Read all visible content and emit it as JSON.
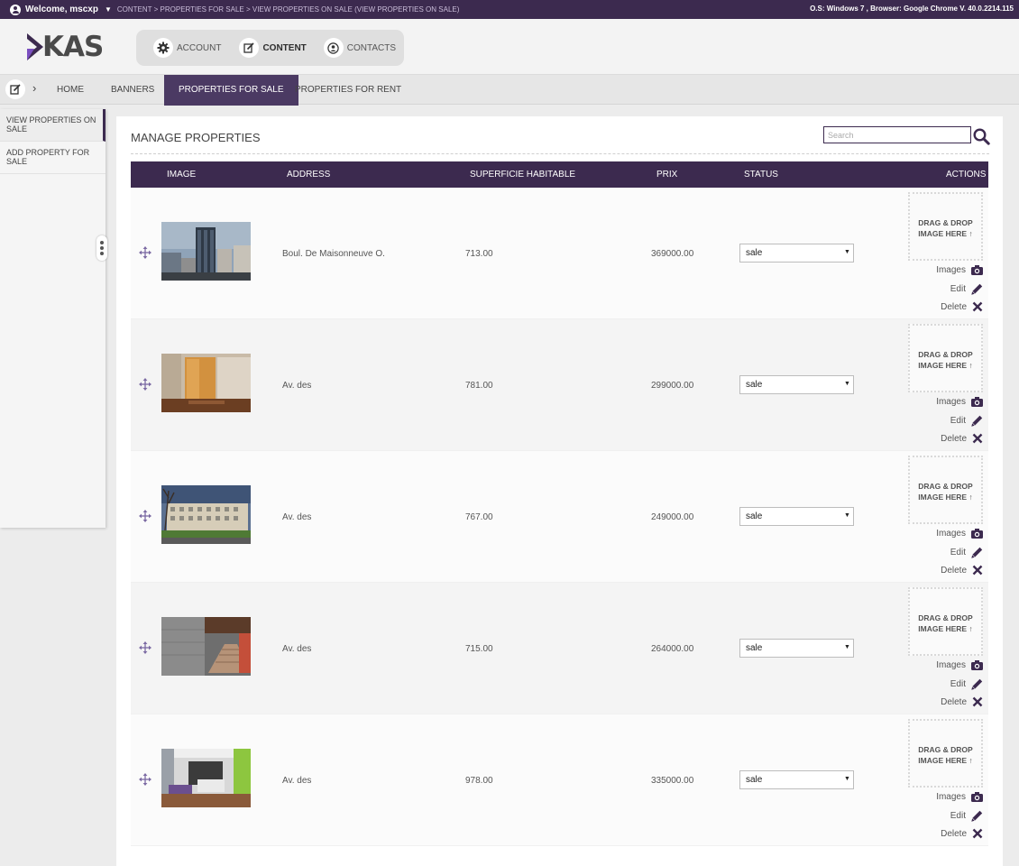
{
  "topbar": {
    "welcome": "Welcome, mscxp",
    "breadcrumb": "CONTENT > PROPERTIES FOR SALE > VIEW PROPERTIES ON SALE (VIEW PROPERTIES ON SALE)",
    "sysinfo": "O.S: Windows 7 , Browser: Google Chrome V. 40.0.2214.115"
  },
  "logo": {
    "text": "KAS"
  },
  "mainnav": {
    "account": "ACCOUNT",
    "content": "CONTENT",
    "contacts": "CONTACTS"
  },
  "subnav": {
    "home": "HOME",
    "banners": "BANNERS",
    "properties_for_sale": "PROPERTIES FOR SALE",
    "properties_for_rent": "PROPERTIES FOR RENT"
  },
  "sidebar": {
    "view": "VIEW PROPERTIES ON SALE",
    "add": "ADD PROPERTY FOR SALE"
  },
  "main": {
    "title": "MANAGE PROPERTIES",
    "search_placeholder": "Search"
  },
  "table": {
    "headers": {
      "image": "IMAGE",
      "address": "ADDRESS",
      "superficie": "SUPERFICIE HABITABLE",
      "prix": "PRIX",
      "status": "STATUS",
      "actions": "ACTIONS"
    },
    "dropzone_line1": "DRAG & DROP",
    "dropzone_line2": "IMAGE HERE ↑",
    "actions": {
      "images": "Images",
      "edit": "Edit",
      "delete": "Delete"
    },
    "rows": [
      {
        "address": "Boul. De Maisonneuve O.",
        "superficie": "713.00",
        "prix": "369000.00",
        "status": "sale"
      },
      {
        "address": "Av. des",
        "superficie": "781.00",
        "prix": "299000.00",
        "status": "sale"
      },
      {
        "address": "Av. des",
        "superficie": "767.00",
        "prix": "249000.00",
        "status": "sale"
      },
      {
        "address": "Av. des",
        "superficie": "715.00",
        "prix": "264000.00",
        "status": "sale"
      },
      {
        "address": "Av. des",
        "superficie": "978.00",
        "prix": "335000.00",
        "status": "sale"
      }
    ]
  },
  "colors": {
    "brand": "#3c2a4f",
    "accent": "#7b4fc0"
  }
}
